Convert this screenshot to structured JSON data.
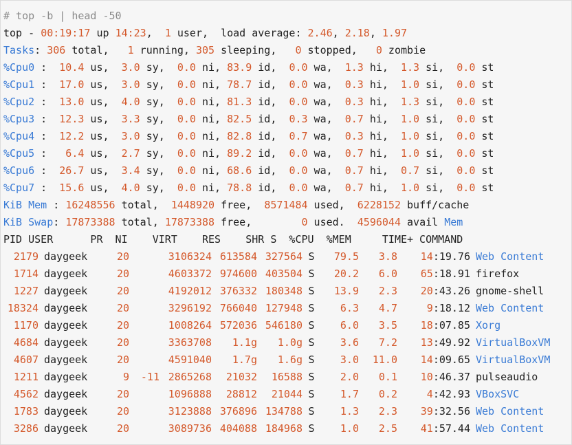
{
  "command_line": "# top -b | head -50",
  "summary": {
    "prefix": "top - ",
    "time": "00:19:17",
    "up_label": " up ",
    "uptime": "14:23",
    "sep1": ",  ",
    "users": "1",
    "users_label": " user,  load average: ",
    "load1": "2.46",
    "lsep1": ", ",
    "load5": "2.18",
    "lsep2": ", ",
    "load15": "1.97"
  },
  "tasks": {
    "label": "Tasks",
    "colon": ": ",
    "total": "306",
    "total_label": " total,   ",
    "running": "1",
    "running_label": " running, ",
    "sleeping": "305",
    "sleeping_label": " sleeping,   ",
    "stopped": "0",
    "stopped_label": " stopped,   ",
    "zombie": "0",
    "zombie_label": " zombie"
  },
  "cpus": [
    {
      "label": "%Cpu0",
      "us": " 10.4",
      "sy": "3.0",
      "ni": "0.0",
      "id": "83.9",
      "wa": "0.0",
      "hi": "1.3",
      "si": "1.3",
      "st": "0.0"
    },
    {
      "label": "%Cpu1",
      "us": " 17.0",
      "sy": "3.0",
      "ni": "0.0",
      "id": "78.7",
      "wa": "0.0",
      "hi": "0.3",
      "si": "1.0",
      "st": "0.0"
    },
    {
      "label": "%Cpu2",
      "us": " 13.0",
      "sy": "4.0",
      "ni": "0.0",
      "id": "81.3",
      "wa": "0.0",
      "hi": "0.3",
      "si": "1.3",
      "st": "0.0"
    },
    {
      "label": "%Cpu3",
      "us": " 12.3",
      "sy": "3.3",
      "ni": "0.0",
      "id": "82.5",
      "wa": "0.3",
      "hi": "0.7",
      "si": "1.0",
      "st": "0.0"
    },
    {
      "label": "%Cpu4",
      "us": " 12.2",
      "sy": "3.0",
      "ni": "0.0",
      "id": "82.8",
      "wa": "0.7",
      "hi": "0.3",
      "si": "1.0",
      "st": "0.0"
    },
    {
      "label": "%Cpu5",
      "us": "  6.4",
      "sy": "2.7",
      "ni": "0.0",
      "id": "89.2",
      "wa": "0.0",
      "hi": "0.7",
      "si": "1.0",
      "st": "0.0"
    },
    {
      "label": "%Cpu6",
      "us": " 26.7",
      "sy": "3.4",
      "ni": "0.0",
      "id": "68.6",
      "wa": "0.0",
      "hi": "0.7",
      "si": "0.7",
      "st": "0.0"
    },
    {
      "label": "%Cpu7",
      "us": " 15.6",
      "sy": "4.0",
      "ni": "0.0",
      "id": "78.8",
      "wa": "0.0",
      "hi": "0.7",
      "si": "1.0",
      "st": "0.0"
    }
  ],
  "cpu_labels": {
    "colon": " : ",
    "us": " us,  ",
    "sy": " sy,  ",
    "ni": " ni, ",
    "id": " id,  ",
    "wa": " wa,  ",
    "hi": " hi,  ",
    "si": " si,  ",
    "st": " st"
  },
  "mem": {
    "label": "KiB Mem",
    "colon": " : ",
    "total": "16248556",
    "total_label": " total,  ",
    "free": "1448920",
    "free_label": " free,  ",
    "used": "8571484",
    "used_label": " used,  ",
    "buff": "6228152",
    "buff_label": " buff/cache"
  },
  "swap": {
    "label": "KiB Swap",
    "colon": ": ",
    "total": "17873388",
    "total_label": " total, ",
    "free": "17873388",
    "free_label": " free,        ",
    "used": "0",
    "used_label": " used.  ",
    "avail": "4596044",
    "avail_label": " avail ",
    "avail_unit": "Mem"
  },
  "header": "PID USER      PR  NI    VIRT    RES    SHR S  %CPU  %MEM     TIME+ COMMAND",
  "colors": {
    "number": "#d4582a",
    "label": "#3a7bd5",
    "comment": "#8a8a8a",
    "text": "#222222",
    "background": "#f6f6f6"
  },
  "processes": [
    {
      "pid": "2179",
      "user": "daygeek",
      "pr": "20",
      "ni": "",
      "virt": "3106324",
      "res": "613584",
      "shr": "327564",
      "s": "S",
      "cpu": "79.5",
      "mem": "3.8",
      "time_h": "14",
      "time_r": ":19.76",
      "cmd": "Web Content",
      "cmd_blue": true
    },
    {
      "pid": "1714",
      "user": "daygeek",
      "pr": "20",
      "ni": "",
      "virt": "4603372",
      "res": "974600",
      "shr": "403504",
      "s": "S",
      "cpu": "20.2",
      "mem": "6.0",
      "time_h": "65",
      "time_r": ":18.91",
      "cmd": "firefox",
      "cmd_blue": false
    },
    {
      "pid": "1227",
      "user": "daygeek",
      "pr": "20",
      "ni": "",
      "virt": "4192012",
      "res": "376332",
      "shr": "180348",
      "s": "S",
      "cpu": "13.9",
      "mem": "2.3",
      "time_h": "20",
      "time_r": ":43.26",
      "cmd": "gnome-shell",
      "cmd_blue": false
    },
    {
      "pid": "18324",
      "user": "daygeek",
      "pr": "20",
      "ni": "",
      "virt": "3296192",
      "res": "766040",
      "shr": "127948",
      "s": "S",
      "cpu": "6.3",
      "mem": "4.7",
      "time_h": "9",
      "time_r": ":18.12",
      "cmd": "Web Content",
      "cmd_blue": true
    },
    {
      "pid": "1170",
      "user": "daygeek",
      "pr": "20",
      "ni": "",
      "virt": "1008264",
      "res": "572036",
      "shr": "546180",
      "s": "S",
      "cpu": "6.0",
      "mem": "3.5",
      "time_h": "18",
      "time_r": ":07.85",
      "cmd": "Xorg",
      "cmd_blue": true
    },
    {
      "pid": "4684",
      "user": "daygeek",
      "pr": "20",
      "ni": "",
      "virt": "3363708",
      "res": "1.1g",
      "shr": "1.0g",
      "s": "S",
      "cpu": "3.6",
      "mem": "7.2",
      "time_h": "13",
      "time_r": ":49.92",
      "cmd": "VirtualBoxVM",
      "cmd_blue": true
    },
    {
      "pid": "4607",
      "user": "daygeek",
      "pr": "20",
      "ni": "",
      "virt": "4591040",
      "res": "1.7g",
      "shr": "1.6g",
      "s": "S",
      "cpu": "3.0",
      "mem": "11.0",
      "time_h": "14",
      "time_r": ":09.65",
      "cmd": "VirtualBoxVM",
      "cmd_blue": true
    },
    {
      "pid": "1211",
      "user": "daygeek",
      "pr": "9",
      "ni": "-11",
      "virt": "2865268",
      "res": "21032",
      "shr": "16588",
      "s": "S",
      "cpu": "2.0",
      "mem": "0.1",
      "time_h": "10",
      "time_r": ":46.37",
      "cmd": "pulseaudio",
      "cmd_blue": false
    },
    {
      "pid": "4562",
      "user": "daygeek",
      "pr": "20",
      "ni": "",
      "virt": "1096888",
      "res": "28812",
      "shr": "21044",
      "s": "S",
      "cpu": "1.7",
      "mem": "0.2",
      "time_h": "4",
      "time_r": ":42.93",
      "cmd": "VBoxSVC",
      "cmd_blue": true
    },
    {
      "pid": "1783",
      "user": "daygeek",
      "pr": "20",
      "ni": "",
      "virt": "3123888",
      "res": "376896",
      "shr": "134788",
      "s": "S",
      "cpu": "1.3",
      "mem": "2.3",
      "time_h": "39",
      "time_r": ":32.56",
      "cmd": "Web Content",
      "cmd_blue": true
    },
    {
      "pid": "3286",
      "user": "daygeek",
      "pr": "20",
      "ni": "",
      "virt": "3089736",
      "res": "404088",
      "shr": "184968",
      "s": "S",
      "cpu": "1.0",
      "mem": "2.5",
      "time_h": "41",
      "time_r": ":57.44",
      "cmd": "Web Content",
      "cmd_blue": true
    }
  ]
}
